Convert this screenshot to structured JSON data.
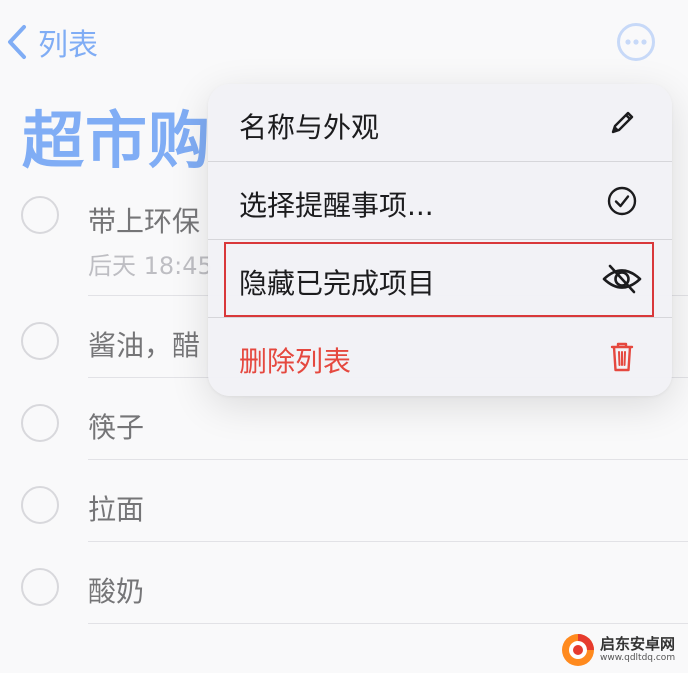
{
  "nav": {
    "back_label": "列表",
    "back_icon": "chevron-left-icon",
    "more_icon": "ellipsis-circle-icon"
  },
  "page": {
    "title": "超市购"
  },
  "reminders": [
    {
      "title": "带上环保",
      "subtitle": "后天 18:45"
    },
    {
      "title": "酱油，醋",
      "subtitle": ""
    },
    {
      "title": "筷子",
      "subtitle": ""
    },
    {
      "title": "拉面",
      "subtitle": ""
    },
    {
      "title": "酸奶",
      "subtitle": ""
    }
  ],
  "menu": {
    "items": [
      {
        "label": "名称与外观",
        "icon": "pencil-icon"
      },
      {
        "label": "选择提醒事项...",
        "icon": "checkmark-circle-icon"
      },
      {
        "label": "隐藏已完成项目",
        "icon": "eye-slash-icon"
      },
      {
        "label": "删除列表",
        "icon": "trash-icon"
      }
    ]
  },
  "watermark": {
    "name": "启东安卓网",
    "url": "www.qdltdq.com"
  },
  "colors": {
    "accent": "#2f7cf6",
    "danger": "#e5483f",
    "highlight": "#d9383a"
  }
}
